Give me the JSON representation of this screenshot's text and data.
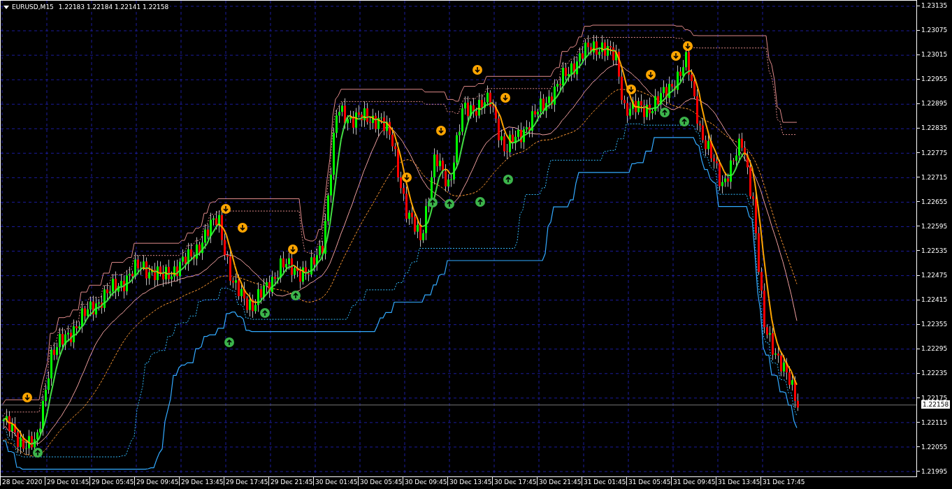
{
  "chart": {
    "title": "EURUSD,M15",
    "quotes": [
      "1.22183",
      "1.22184",
      "1.22141",
      "1.22158"
    ],
    "price_axis": [
      "1.23135",
      "1.23075",
      "1.23015",
      "1.22955",
      "1.22895",
      "1.22835",
      "1.22775",
      "1.22715",
      "1.22655",
      "1.22595",
      "1.22535",
      "1.22475",
      "1.22415",
      "1.22355",
      "1.22295",
      "1.22235",
      "1.22175",
      "1.22115",
      "1.22055",
      "1.21995"
    ],
    "current_price": "1.22158",
    "time_axis": [
      "28 Dec 2020",
      "29 Dec 01:45",
      "29 Dec 05:45",
      "29 Dec 09:45",
      "29 Dec 13:45",
      "29 Dec 17:45",
      "29 Dec 21:45",
      "30 Dec 01:45",
      "30 Dec 05:45",
      "30 Dec 09:45",
      "30 Dec 13:45",
      "30 Dec 17:45",
      "30 Dec 21:45",
      "31 Dec 01:45",
      "31 Dec 05:45",
      "31 Dec 09:45",
      "31 Dec 13:45",
      "31 Dec 17:45"
    ]
  }
}
